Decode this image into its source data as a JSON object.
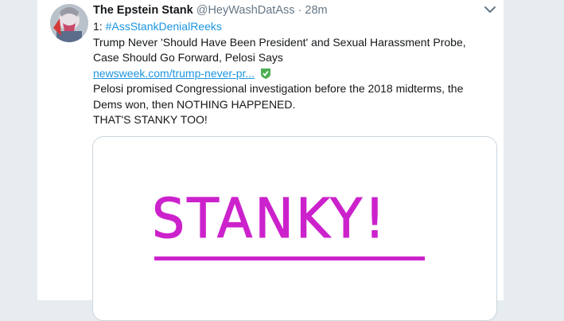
{
  "tweet": {
    "display_name": "The Epstein Stank",
    "handle": "@HeyWashDatAss",
    "separator": "·",
    "time": "28m",
    "hashtag_prefix": "1: ",
    "hashtag": "#AssStankDenialReeks",
    "headline": "Trump Never 'Should Have Been President' and Sexual Harassment Probe, Case Should Go Forward, Pelosi Says",
    "link_text": "newsweek.com/trump-never-pr...",
    "body_line1": "Pelosi promised Congressional investigation before the 2018 midterms, the Dems won, then NOTHING HAPPENED.",
    "body_line2": "THAT'S STANKY TOO!",
    "media_text": "STANKY!"
  },
  "icons": {
    "menu": "chevron-down-icon",
    "verified_link": "green-check-shield-icon"
  },
  "colors": {
    "accent": "#1b95e0",
    "stanky": "#cc22cc",
    "check": "#4caf50"
  }
}
